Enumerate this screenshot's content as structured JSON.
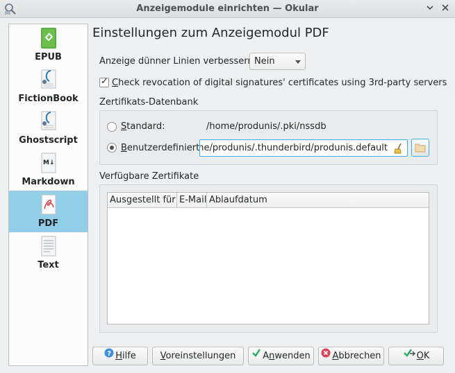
{
  "window": {
    "title": "Anzeigemodule einrichten — Okular"
  },
  "sidebar": {
    "items": [
      {
        "label": "EPUB",
        "icon": "epub-icon"
      },
      {
        "label": "FictionBook",
        "icon": "fictionbook-icon"
      },
      {
        "label": "Ghostscript",
        "icon": "ghostscript-icon"
      },
      {
        "label": "Markdown",
        "icon": "markdown-icon"
      },
      {
        "label": "PDF",
        "icon": "pdf-icon",
        "selected": true
      },
      {
        "label": "Text",
        "icon": "text-icon"
      }
    ]
  },
  "page": {
    "heading": "Einstellungen zum Anzeigemodul PDF"
  },
  "thin_lines": {
    "label": "Anzeige dünner Linien verbessern:",
    "value": "Nein"
  },
  "revocation": {
    "checked": true,
    "label_first": "C",
    "label_rest": "heck revocation of digital signatures' certificates using 3rd-party servers"
  },
  "cert_db": {
    "title": "Zertifikats-Datenbank",
    "standard_first": "S",
    "standard_rest": "tandard:",
    "standard_path": "/home/produnis/.pki/nssdb",
    "custom_first": "B",
    "custom_rest": "enutzerdefiniert:",
    "custom_path": "/home/produnis/.thunderbird/produnis.default",
    "selected": "custom"
  },
  "certs": {
    "title": "Verfügbare Zertifikate",
    "columns": [
      "Ausgestellt für",
      "E-Mail",
      "Ablaufdatum"
    ],
    "rows": []
  },
  "buttons": {
    "help_first": "H",
    "help_rest": "ilfe",
    "defaults_first": "V",
    "defaults_rest": "oreinstellungen",
    "apply_pre": "A",
    "apply_acc": "n",
    "apply_rest": "wenden",
    "cancel_first": "A",
    "cancel_rest": "bbrechen",
    "ok_first": "O",
    "ok_rest": "K"
  },
  "colors": {
    "selection": "#93cee9",
    "accent": "#3daee9",
    "background": "#eff0f1"
  }
}
